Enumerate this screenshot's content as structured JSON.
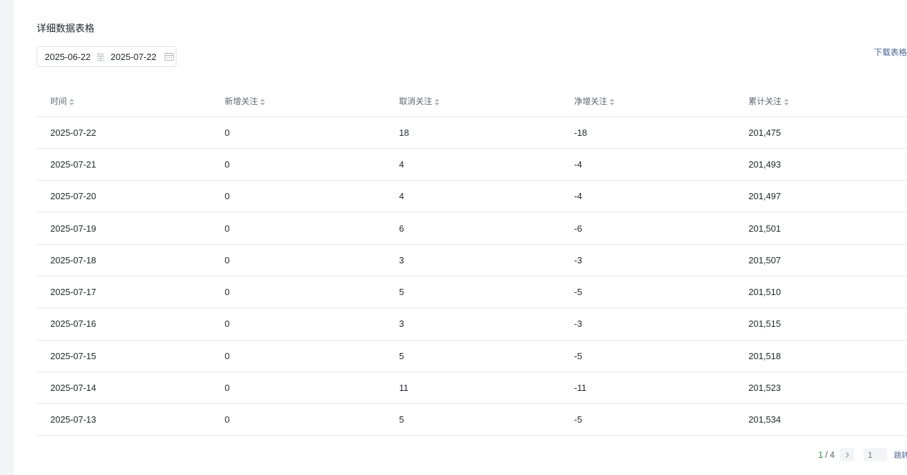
{
  "section": {
    "title": "详细数据表格"
  },
  "date_range": {
    "start": "2025-06-22",
    "separator": "至",
    "end": "2025-07-22"
  },
  "actions": {
    "download_label": "下载表格"
  },
  "table": {
    "columns": [
      "时间",
      "新增关注",
      "取消关注",
      "净增关注",
      "累计关注"
    ],
    "rows": [
      [
        "2025-07-22",
        "0",
        "18",
        "-18",
        "201,475"
      ],
      [
        "2025-07-21",
        "0",
        "4",
        "-4",
        "201,493"
      ],
      [
        "2025-07-20",
        "0",
        "4",
        "-4",
        "201,497"
      ],
      [
        "2025-07-19",
        "0",
        "6",
        "-6",
        "201,501"
      ],
      [
        "2025-07-18",
        "0",
        "3",
        "-3",
        "201,507"
      ],
      [
        "2025-07-17",
        "0",
        "5",
        "-5",
        "201,510"
      ],
      [
        "2025-07-16",
        "0",
        "3",
        "-3",
        "201,515"
      ],
      [
        "2025-07-15",
        "0",
        "5",
        "-5",
        "201,518"
      ],
      [
        "2025-07-14",
        "0",
        "11",
        "-11",
        "201,523"
      ],
      [
        "2025-07-13",
        "0",
        "5",
        "-5",
        "201,534"
      ]
    ]
  },
  "pagination": {
    "current": "1",
    "separator": "/",
    "total": "4",
    "input_placeholder": "1",
    "jump_label": "跳转"
  },
  "colors": {
    "accent_green": "#2aa14b",
    "link_blue": "#4a6496",
    "border": "#e5e7eb"
  }
}
